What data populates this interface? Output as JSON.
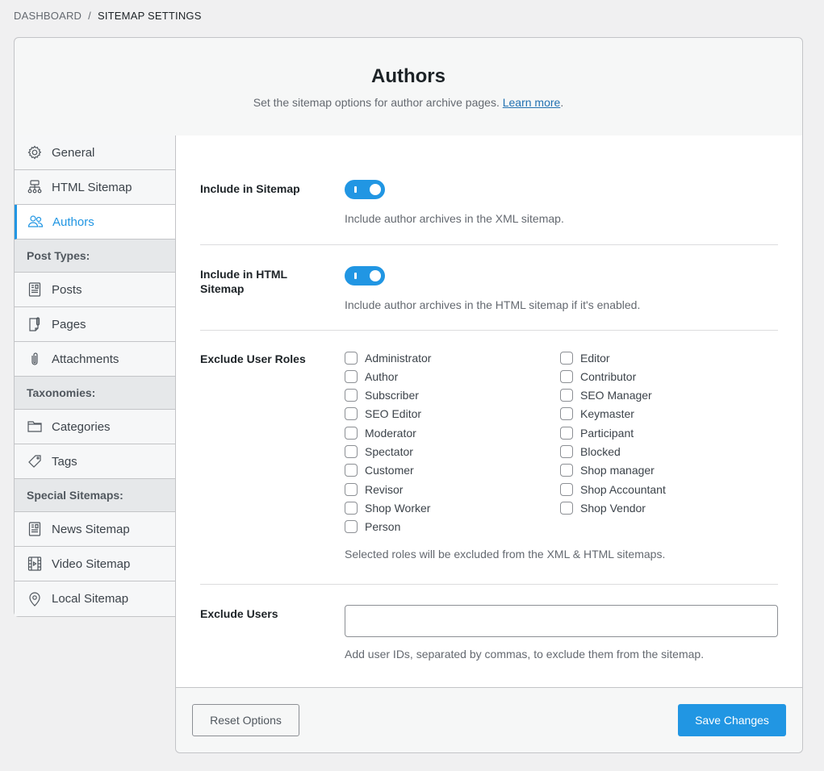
{
  "breadcrumb": {
    "parent": "DASHBOARD",
    "separator": "/",
    "current": "SITEMAP SETTINGS"
  },
  "header": {
    "title": "Authors",
    "description": "Set the sitemap options for author archive pages.",
    "learn_more": "Learn more",
    "after_link": "."
  },
  "sidebar": {
    "items": [
      {
        "label": "General",
        "icon": "gear-icon"
      },
      {
        "label": "HTML Sitemap",
        "icon": "sitemap-icon"
      },
      {
        "label": "Authors",
        "icon": "users-icon",
        "active": true
      }
    ],
    "groups": [
      {
        "label": "Post Types:",
        "items": [
          {
            "label": "Posts",
            "icon": "post-icon"
          },
          {
            "label": "Pages",
            "icon": "page-icon"
          },
          {
            "label": "Attachments",
            "icon": "paperclip-icon"
          }
        ]
      },
      {
        "label": "Taxonomies:",
        "items": [
          {
            "label": "Categories",
            "icon": "folder-icon"
          },
          {
            "label": "Tags",
            "icon": "tag-icon"
          }
        ]
      },
      {
        "label": "Special Sitemaps:",
        "items": [
          {
            "label": "News Sitemap",
            "icon": "news-icon"
          },
          {
            "label": "Video Sitemap",
            "icon": "video-icon"
          },
          {
            "label": "Local Sitemap",
            "icon": "location-pin-icon"
          }
        ]
      }
    ]
  },
  "settings": {
    "include_sitemap": {
      "label": "Include in Sitemap",
      "enabled": true,
      "help": "Include author archives in the XML sitemap."
    },
    "include_html_sitemap": {
      "label": "Include in HTML Sitemap",
      "enabled": true,
      "help": "Include author archives in the HTML sitemap if it's enabled."
    },
    "exclude_roles": {
      "label": "Exclude User Roles",
      "roles_left": [
        "Administrator",
        "Author",
        "Subscriber",
        "SEO Editor",
        "Moderator",
        "Spectator",
        "Customer",
        "Revisor",
        "Shop Worker",
        "Person"
      ],
      "roles_right": [
        "Editor",
        "Contributor",
        "SEO Manager",
        "Keymaster",
        "Participant",
        "Blocked",
        "Shop manager",
        "Shop Accountant",
        "Shop Vendor"
      ],
      "help": "Selected roles will be excluded from the XML & HTML sitemaps."
    },
    "exclude_users": {
      "label": "Exclude Users",
      "value": "",
      "help": "Add user IDs, separated by commas, to exclude them from the sitemap."
    }
  },
  "footer": {
    "reset_label": "Reset Options",
    "save_label": "Save Changes"
  },
  "colors": {
    "accent": "#2196e3",
    "link": "#2271b1"
  }
}
